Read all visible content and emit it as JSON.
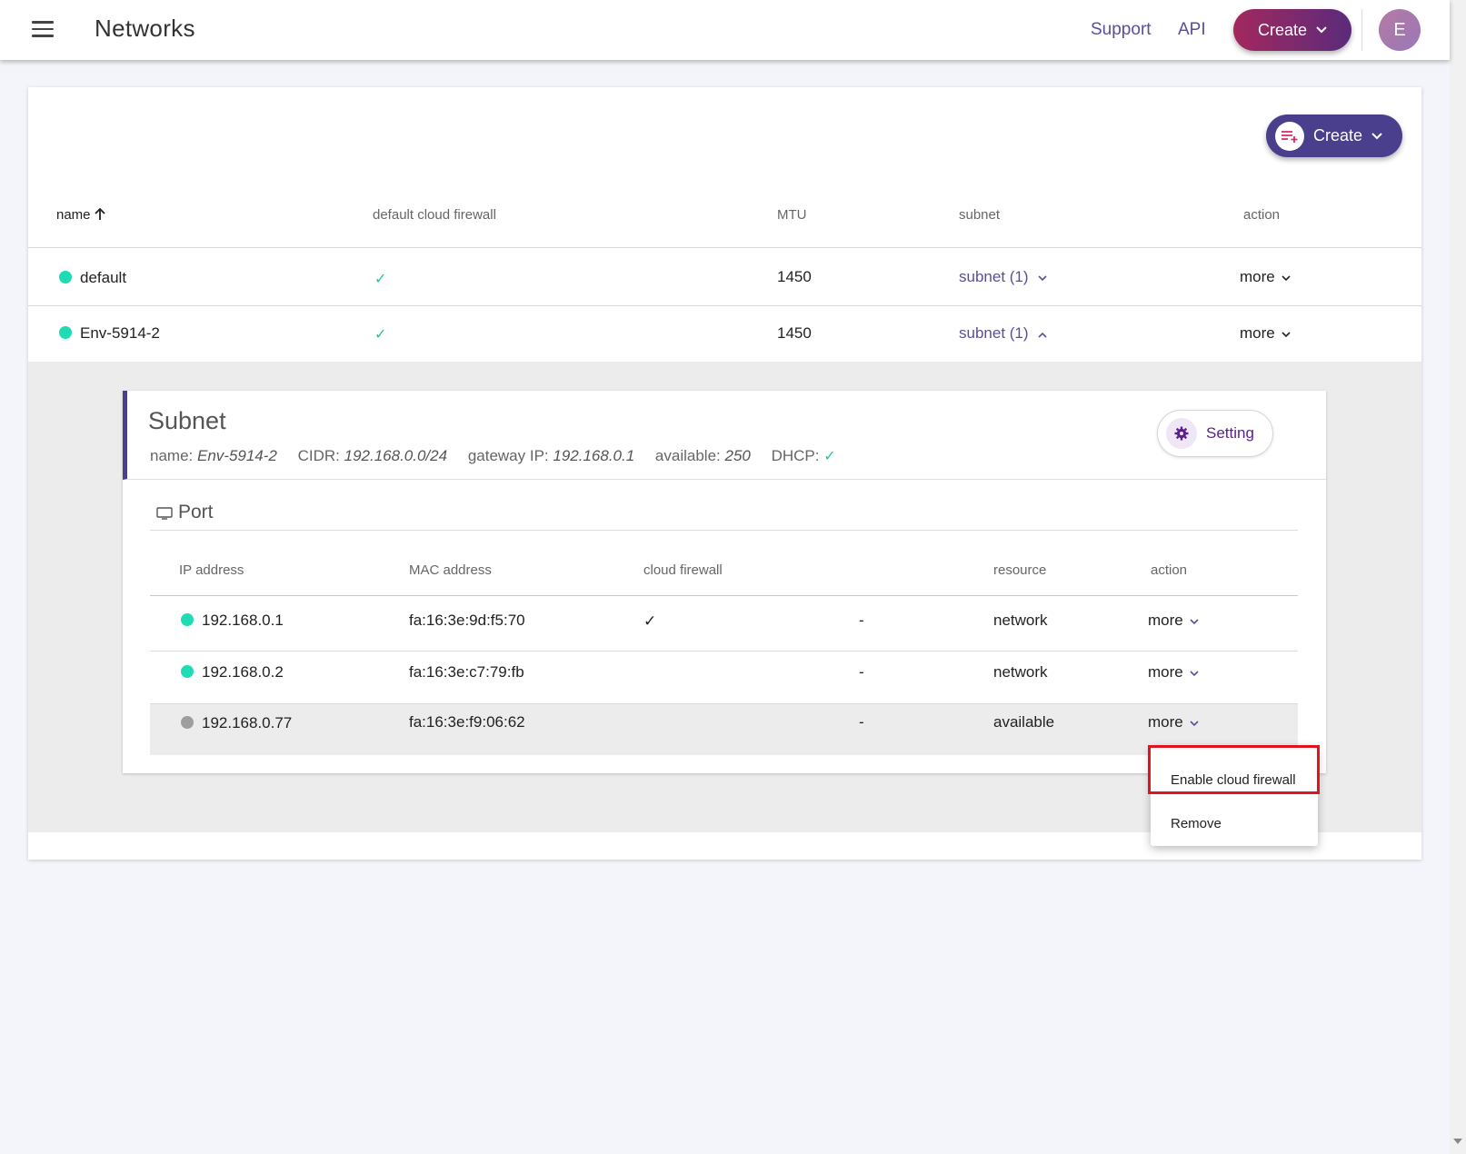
{
  "header": {
    "title": "Networks",
    "support_label": "Support",
    "api_label": "API",
    "create_label": "Create",
    "avatar_letter": "E"
  },
  "card": {
    "create_label": "Create"
  },
  "table": {
    "columns": {
      "name": "name",
      "firewall": "default cloud firewall",
      "mtu": "MTU",
      "subnet": "subnet",
      "action": "action"
    },
    "rows": [
      {
        "name": "default",
        "status": "active",
        "firewall": "✓",
        "mtu": "1450",
        "subnet": "subnet (1)",
        "action": "more"
      },
      {
        "name": "Env-5914-2",
        "status": "active",
        "firewall": "✓",
        "mtu": "1450",
        "subnet": "subnet (1)",
        "action": "more"
      }
    ]
  },
  "subnet": {
    "title": "Subnet",
    "name_label": "name:",
    "name_value": "Env-5914-2",
    "cidr_label": "CIDR:",
    "cidr_value": "192.168.0.0/24",
    "gateway_label": "gateway IP:",
    "gateway_value": "192.168.0.1",
    "available_label": "available:",
    "available_value": "250",
    "dhcp_label": "DHCP:",
    "dhcp_value": "✓",
    "setting_label": "Setting"
  },
  "ports": {
    "title": "Port",
    "columns": {
      "ip": "IP address",
      "mac": "MAC address",
      "firewall": "cloud firewall",
      "resource": "resource",
      "action": "action"
    },
    "rows": [
      {
        "ip": "192.168.0.1",
        "status": "active",
        "mac": "fa:16:3e:9d:f5:70",
        "firewall": "✓",
        "dash": "-",
        "resource": "network",
        "action": "more"
      },
      {
        "ip": "192.168.0.2",
        "status": "active",
        "mac": "fa:16:3e:c7:79:fb",
        "firewall": "",
        "dash": "-",
        "resource": "network",
        "action": "more"
      },
      {
        "ip": "192.168.0.77",
        "status": "inactive",
        "mac": "fa:16:3e:f9:06:62",
        "firewall": "",
        "dash": "-",
        "resource": "available",
        "action": "more"
      }
    ]
  },
  "menu": {
    "items": [
      "Enable cloud firewall",
      "Remove"
    ]
  },
  "colors": {
    "accent": "#5a4e9c",
    "status_active": "#1fdcb4",
    "status_inactive": "#9e9e9e",
    "highlight": "#e0141e"
  }
}
